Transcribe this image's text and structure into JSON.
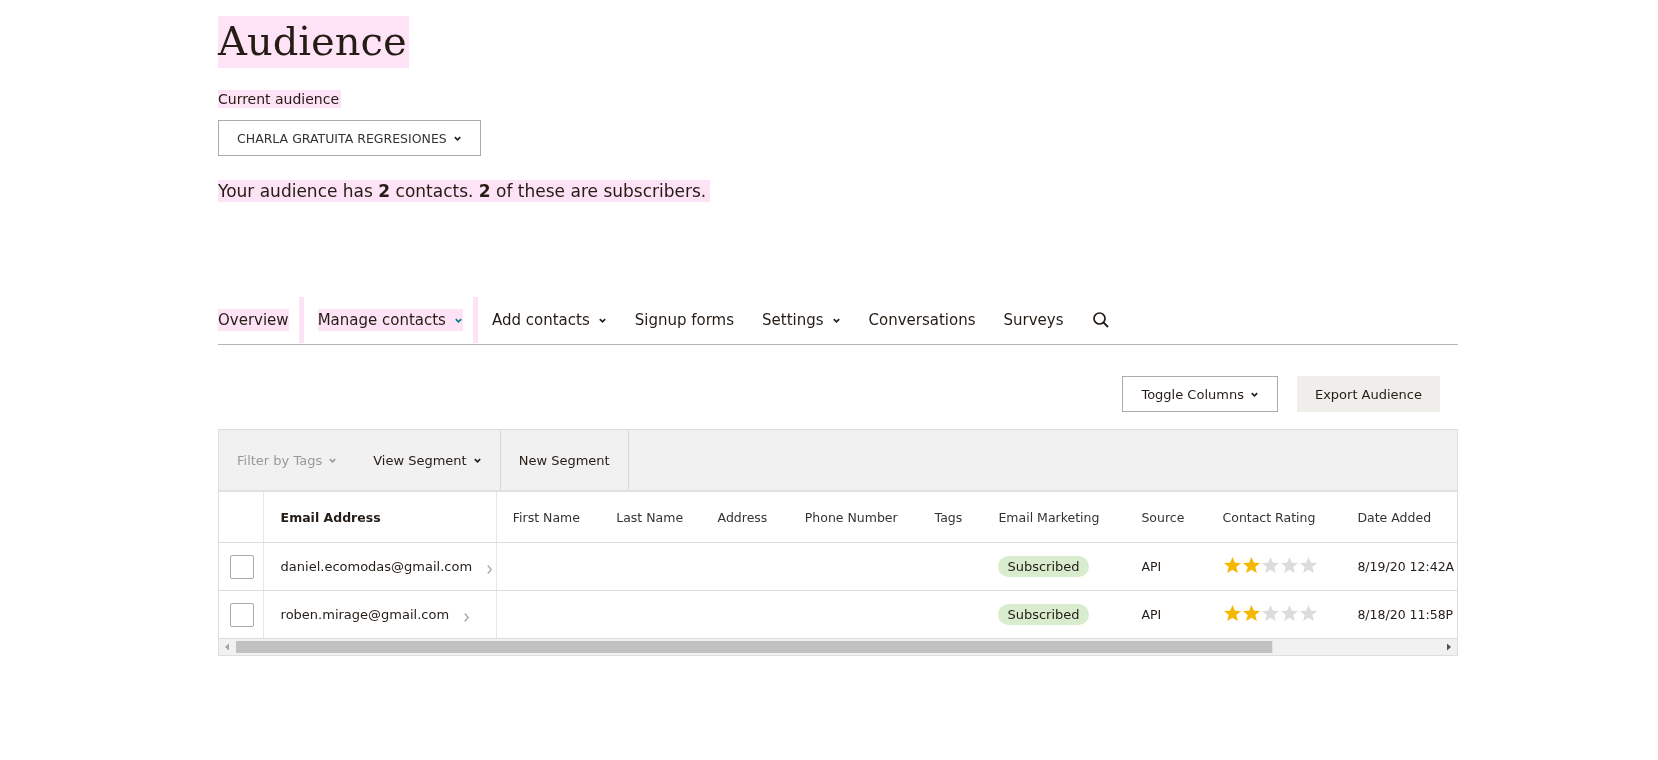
{
  "page": {
    "title": "Audience",
    "audience_label": "Current audience",
    "audience_dropdown": "CHARLA GRATUITA REGRESIONES",
    "summary": "Your audience has **2** contacts. **2** of these are subscribers."
  },
  "tabs": [
    {
      "label": "Overview",
      "kind": "link",
      "highlighted": true
    },
    {
      "label": "Manage contacts",
      "kind": "active-menu",
      "highlighted": true
    },
    {
      "label": "Add contacts",
      "kind": "menu",
      "highlighted": false
    },
    {
      "label": "Signup forms",
      "kind": "link",
      "highlighted": false
    },
    {
      "label": "Settings",
      "kind": "menu",
      "highlighted": false
    },
    {
      "label": "Conversations",
      "kind": "link",
      "highlighted": false
    },
    {
      "label": "Surveys",
      "kind": "link",
      "highlighted": false
    }
  ],
  "actions": [
    {
      "label": "Toggle Columns",
      "kind": "dropdown"
    },
    {
      "label": "Export Audience",
      "kind": "button"
    }
  ],
  "toolbar": [
    {
      "label": "Filter by Tags",
      "kind": "dropdown",
      "disabled": true
    },
    {
      "label": "View Segment",
      "kind": "dropdown",
      "disabled": false
    },
    {
      "label": "New Segment",
      "kind": "button",
      "disabled": false
    }
  ],
  "table": {
    "columns": [
      "Email Address",
      "First Name",
      "Last Name",
      "Address",
      "Phone Number",
      "Tags",
      "Email Marketing",
      "Source",
      "Contact Rating",
      "Date Added"
    ],
    "rows": [
      {
        "checked": false,
        "email": "daniel.ecomodas@gmail.com",
        "email_marketing": "Subscribed",
        "source": "API",
        "stars": 2,
        "date_added": "8/19/20 12:42A"
      },
      {
        "checked": false,
        "email": "roben.mirage@gmail.com",
        "email_marketing": "Subscribed",
        "source": "API",
        "stars": 2,
        "date_added": "8/18/20 11:58P"
      }
    ]
  }
}
